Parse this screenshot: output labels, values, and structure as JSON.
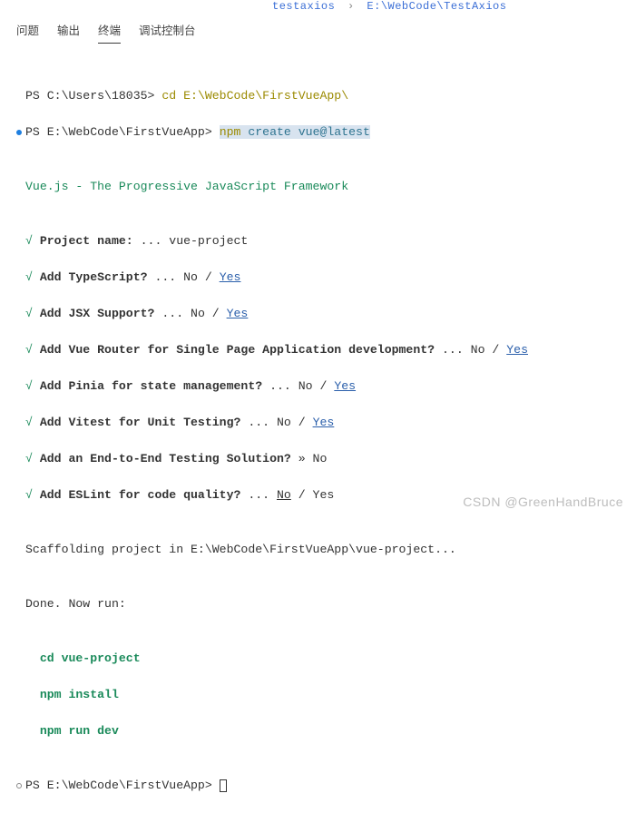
{
  "breadcrumb": {
    "a": "testaxios",
    "b": "E:\\WebCode\\TestAxios"
  },
  "tabs": {
    "problems": "问题",
    "output": "输出",
    "terminal": "终端",
    "debug": "调试控制台"
  },
  "t": {
    "ps1": "PS C:\\Users\\18035> ",
    "cd": "cd E:\\WebCode\\FirstVueApp\\",
    "ps2": "PS E:\\WebCode\\FirstVueApp> ",
    "npm": "npm ",
    "create": "create vue@latest",
    "title": "Vue.js - The Progressive JavaScript Framework",
    "check": "√ ",
    "q1": "Project name: ",
    "q1b": "... vue-project",
    "q2": "Add TypeScript? ",
    "q2b": "... No / ",
    "q2y": "Yes",
    "q3": "Add JSX Support? ",
    "q3b": "... No / ",
    "q3y": "Yes",
    "q4": "Add Vue Router for Single Page Application development? ",
    "q4b": "... No / ",
    "q4y": "Yes",
    "q5": "Add Pinia for state management? ",
    "q5b": "... No / ",
    "q5y": "Yes",
    "q6": "Add Vitest for Unit Testing? ",
    "q6b": "... No / ",
    "q6y": "Yes",
    "q7": "Add an End-to-End Testing Solution? ",
    "q7b": "» No",
    "q8": "Add ESLint for code quality? ",
    "q8b": "... ",
    "q8n": "No",
    "q8c": " / Yes",
    "scaf": "Scaffolding project in E:\\WebCode\\FirstVueApp\\vue-project...",
    "done": "Done. Now run:",
    "c1": "  cd vue-project",
    "c2": "  npm install",
    "c3": "  npm run dev",
    "ps3": "PS E:\\WebCode\\FirstVueApp> "
  },
  "watermark": "CSDN @GreenHandBruce"
}
